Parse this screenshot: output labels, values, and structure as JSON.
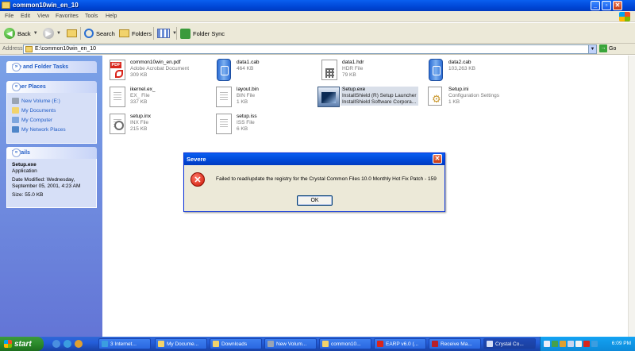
{
  "window": {
    "title": "common10win_en_10"
  },
  "menu": [
    "File",
    "Edit",
    "View",
    "Favorites",
    "Tools",
    "Help"
  ],
  "toolbar": {
    "back": "Back",
    "search": "Search",
    "folders": "Folders",
    "folder_sync": "Folder Sync"
  },
  "address": {
    "label": "Address",
    "value": "E:\\common10win_en_10",
    "go": "Go"
  },
  "left_pane": {
    "file_folder_tasks": "File and Folder Tasks",
    "other_places": {
      "title": "Other Places",
      "items": [
        "New Volume (E:)",
        "My Documents",
        "My Computer",
        "My Network Places"
      ]
    },
    "details": {
      "title": "Details",
      "name": "Setup.exe",
      "type": "Application",
      "modified": "Date Modified: Wednesday, September 05, 2001, 4:23 AM",
      "size": "Size: 55.0 KB"
    }
  },
  "files": [
    {
      "name": "common10win_en.pdf",
      "type": "Adobe Acrobat Document",
      "size": "309 KB",
      "icon": "pdf-icon"
    },
    {
      "name": "data1.cab",
      "type": "",
      "size": "464 KB",
      "icon": "cab-icon"
    },
    {
      "name": "data1.hdr",
      "type": "HDR File",
      "size": "79 KB",
      "icon": "hdr-icon"
    },
    {
      "name": "data2.cab",
      "type": "",
      "size": "103,263 KB",
      "icon": "cab-icon"
    },
    {
      "name": "ikernel.ex_",
      "type": "EX_ File",
      "size": "337 KB",
      "icon": "document-icon"
    },
    {
      "name": "layout.bin",
      "type": "BIN File",
      "size": "1 KB",
      "icon": "document-icon"
    },
    {
      "name": "Setup.exe",
      "type": "InstallShield (R) Setup Launcher",
      "size": "InstallShield Software Corpora...",
      "icon": "setup-exe-icon"
    },
    {
      "name": "Setup.ini",
      "type": "Configuration Settings",
      "size": "1 KB",
      "icon": "ini-icon"
    },
    {
      "name": "setup.inx",
      "type": "INX File",
      "size": "215 KB",
      "icon": "document-icon"
    },
    {
      "name": "setup.iss",
      "type": "ISS File",
      "size": "6 KB",
      "icon": "document-icon"
    }
  ],
  "dialog": {
    "title": "Severe",
    "message": "Failed to read/update the registry for the Crystal Common Files 10.0 Monthly Hot Fix Patch - 159",
    "ok": "OK"
  },
  "taskbar": {
    "start": "start",
    "tasks": [
      "3 Internet...",
      "My Docume...",
      "Downloads",
      "New Volum...",
      "common10...",
      "EARP v6.0 (...",
      "Receive Ma...",
      "Crystal Co..."
    ],
    "clock": "6:09 PM"
  },
  "colors": {
    "xp_blue": "#0a5ff0",
    "task_pane": "#7ba2e7",
    "start_green": "#2b8b2b",
    "error_red": "#cc1100"
  }
}
